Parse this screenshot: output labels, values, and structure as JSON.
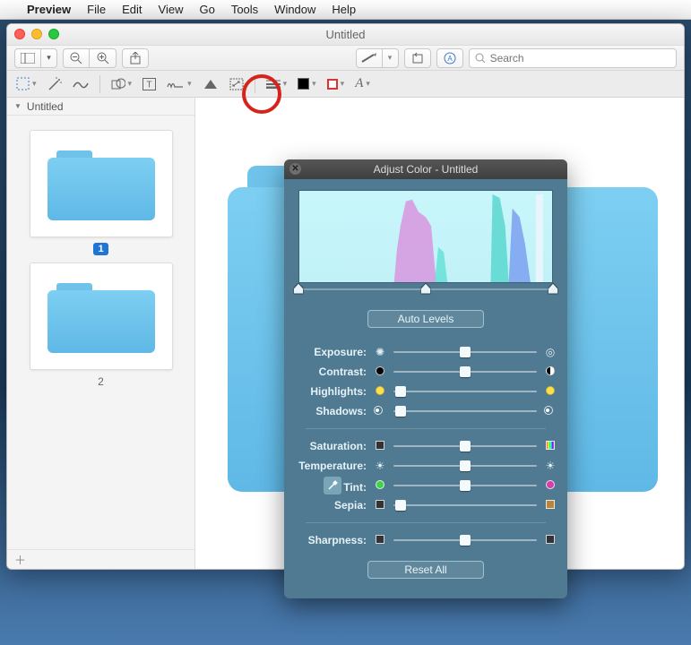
{
  "menubar": {
    "app": "Preview",
    "items": [
      "File",
      "Edit",
      "View",
      "Go",
      "Tools",
      "Window",
      "Help"
    ]
  },
  "window": {
    "title": "Untitled"
  },
  "toolbar1": {
    "search_placeholder": "Search"
  },
  "sidebar": {
    "title": "Untitled",
    "thumbs": [
      {
        "label": "1",
        "selected": true
      },
      {
        "label": "2",
        "selected": false
      }
    ]
  },
  "adjust_panel": {
    "title": "Adjust Color - Untitled",
    "auto_levels": "Auto Levels",
    "reset_all": "Reset All",
    "level_positions": {
      "black": 0,
      "mid": 50,
      "white": 100
    },
    "groups": [
      [
        {
          "key": "exposure",
          "label": "Exposure:",
          "pos": 50,
          "left_icon": "aperture",
          "right_icon": "aperture-open"
        },
        {
          "key": "contrast",
          "label": "Contrast:",
          "pos": 50,
          "left_icon": "dot-black",
          "right_icon": "dot-half"
        },
        {
          "key": "highlights",
          "label": "Highlights:",
          "pos": 5,
          "left_icon": "dot-yellow",
          "right_icon": "dot-yellow"
        },
        {
          "key": "shadows",
          "label": "Shadows:",
          "pos": 5,
          "left_icon": "radio",
          "right_icon": "radio"
        }
      ],
      [
        {
          "key": "saturation",
          "label": "Saturation:",
          "pos": 50,
          "left_icon": "sq-gray",
          "right_icon": "sq-rainbow"
        },
        {
          "key": "temperature",
          "label": "Temperature:",
          "pos": 50,
          "left_icon": "sun",
          "right_icon": "sun"
        },
        {
          "key": "tint",
          "label": "Tint:",
          "pos": 50,
          "left_icon": "dot-green",
          "right_icon": "dot-magenta",
          "prefix_eyedrop": true
        },
        {
          "key": "sepia",
          "label": "Sepia:",
          "pos": 5,
          "left_icon": "sq-gray",
          "right_icon": "sq-sepia"
        }
      ],
      [
        {
          "key": "sharpness",
          "label": "Sharpness:",
          "pos": 50,
          "left_icon": "sq-gray",
          "right_icon": "sq-gray"
        }
      ]
    ]
  }
}
